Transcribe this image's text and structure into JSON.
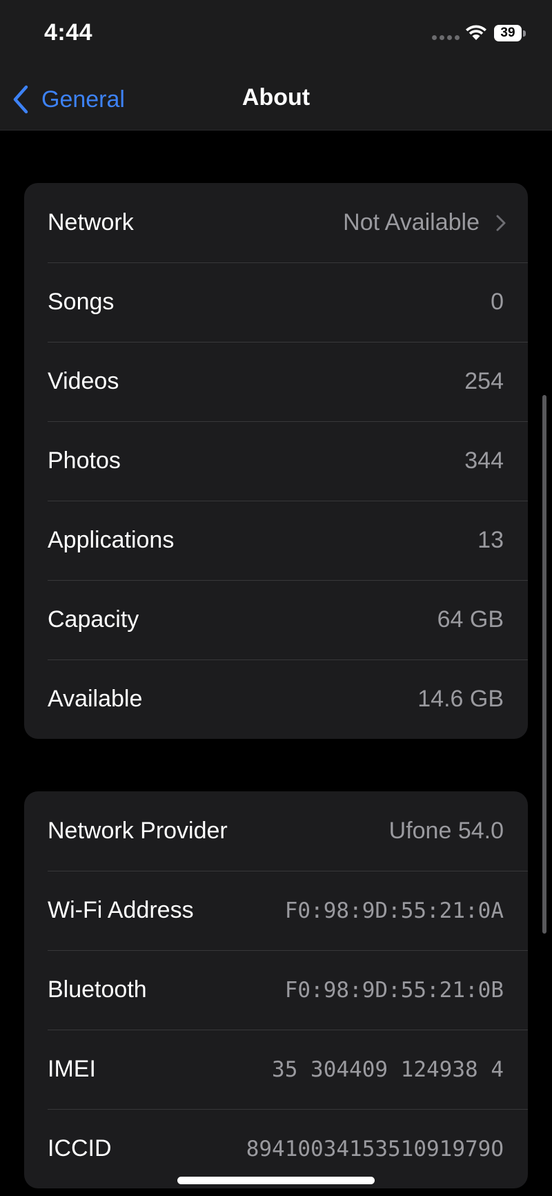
{
  "status_bar": {
    "time": "4:44",
    "battery": "39"
  },
  "nav": {
    "back_label": "General",
    "title": "About"
  },
  "groups": [
    {
      "rows": [
        {
          "label": "Network",
          "value": "Not Available"
        },
        {
          "label": "Songs",
          "value": "0"
        },
        {
          "label": "Videos",
          "value": "254"
        },
        {
          "label": "Photos",
          "value": "344"
        },
        {
          "label": "Applications",
          "value": "13"
        },
        {
          "label": "Capacity",
          "value": "64 GB"
        },
        {
          "label": "Available",
          "value": "14.6 GB"
        }
      ]
    },
    {
      "rows": [
        {
          "label": "Network Provider",
          "value": "Ufone 54.0"
        },
        {
          "label": "Wi-Fi Address",
          "value": "F0:98:9D:55:21:0A"
        },
        {
          "label": "Bluetooth",
          "value": "F0:98:9D:55:21:0B"
        },
        {
          "label": "IMEI",
          "value": "35 304409 124938 4"
        },
        {
          "label": "ICCID",
          "value": "8941003415351091979O"
        }
      ]
    }
  ],
  "icons": {
    "back": "chevron-left-icon",
    "disclosure": "chevron-right-icon",
    "wifi": "wifi-icon",
    "battery": "battery-icon"
  },
  "colors": {
    "background": "#000000",
    "cell": "#1c1c1e",
    "accent": "#3d82f6",
    "secondary_text": "#9a9a9f"
  }
}
